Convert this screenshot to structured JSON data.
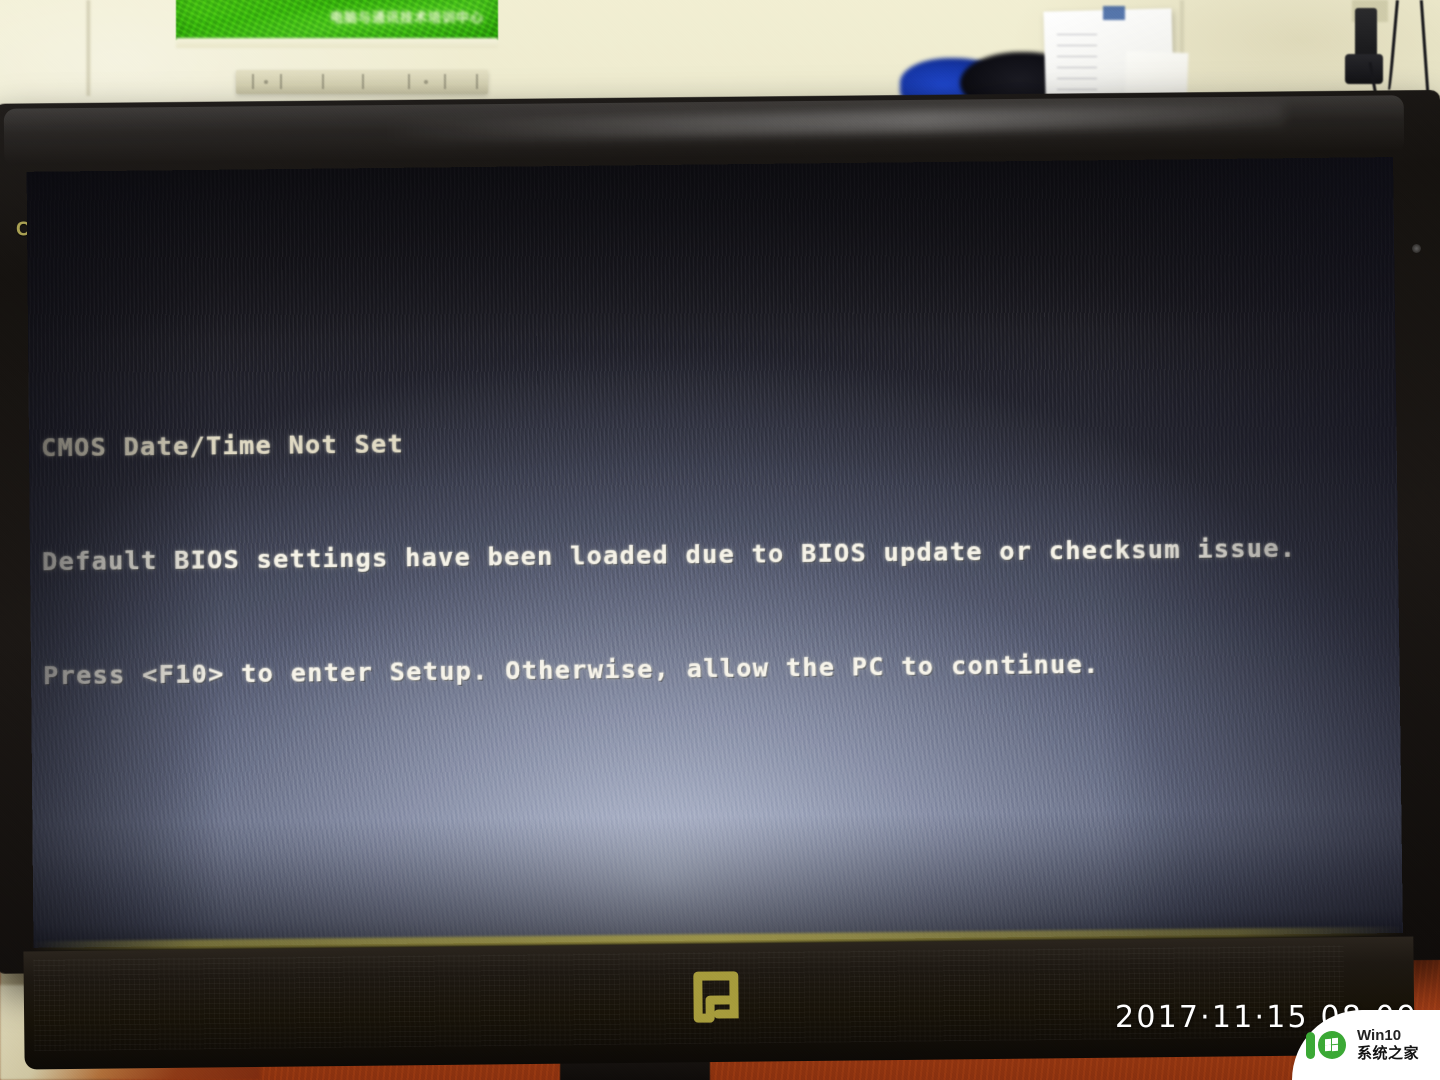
{
  "photo": {
    "scene": "desk-photo-of-compaq-monitor-showing-bios-message",
    "timestamp": "2017·11·15 08:09"
  },
  "monitor": {
    "brand_logo": "COMPAQ",
    "bottom_logo": "q-mark-icon",
    "power_led": "power-led"
  },
  "background": {
    "poster_text": "电脑与通讯技术培训中心",
    "poster_color": "#3fb310",
    "wall_color": "#efecd0",
    "desk_color": "#a03d16"
  },
  "screen": {
    "background_color": "#585d72",
    "text_color": "#f3f0e6",
    "lines": [
      "CMOS Date/Time Not Set",
      "Default BIOS settings have been loaded due to BIOS update or checksum issue.",
      "Press <F10> to enter Setup. Otherwise, allow the PC to continue."
    ],
    "line1": "CMOS Date/Time Not Set",
    "line2": "Default BIOS settings have been loaded due to BIOS update or checksum issue.",
    "line3": "Press <F10> to enter Setup. Otherwise, allow the PC to continue."
  },
  "watermark": {
    "brand_top": "Win10",
    "brand_bottom": "系统之家",
    "accent_color": "#3ba935"
  }
}
